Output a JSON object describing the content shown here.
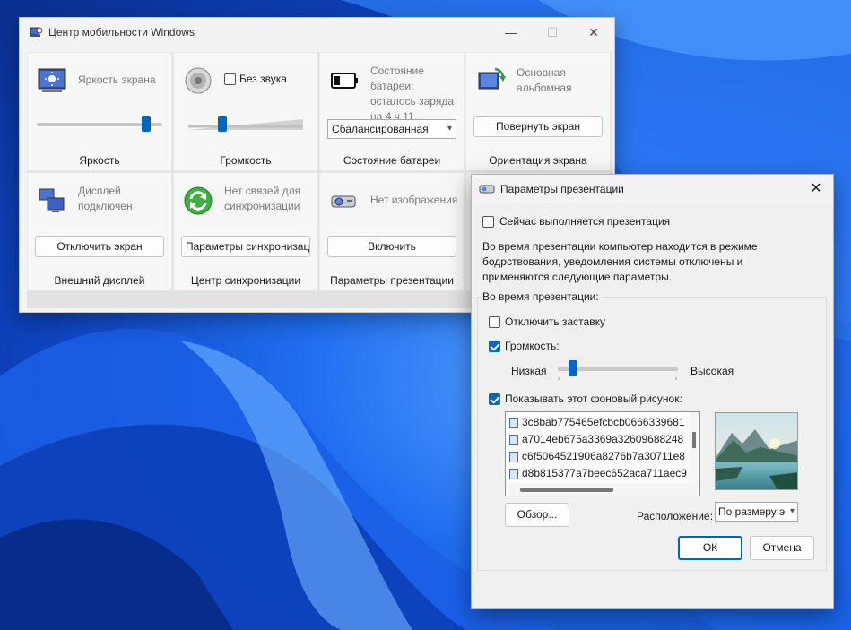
{
  "mobility": {
    "title": "Центр мобильности Windows",
    "brightness": {
      "desc": "Яркость экрана",
      "footer": "Яркость",
      "level": 0.9
    },
    "volume": {
      "mute_label": "Без звука",
      "muted": false,
      "footer": "Громкость",
      "level": 0.28
    },
    "battery": {
      "desc": "Состояние батареи: осталось заряда на 4 ч 11...",
      "plan": "Сбалансированная",
      "footer": "Состояние батареи"
    },
    "orientation": {
      "desc": "Основная альбомная",
      "button": "Повернуть экран",
      "footer": "Ориентация экрана"
    },
    "display": {
      "desc": "Дисплей подключен",
      "button": "Отключить экран",
      "footer": "Внешний дисплей"
    },
    "sync": {
      "desc": "Нет связей для синхронизации",
      "button": "Параметры синхронизации",
      "footer": "Центр синхронизации"
    },
    "presentation": {
      "desc": "Нет изображения",
      "button": "Включить",
      "footer": "Параметры презентации"
    }
  },
  "dialog": {
    "title": "Параметры презентации",
    "presenting_label": "Сейчас выполняется презентация",
    "presenting_checked": false,
    "info_line1": "Во время презентации компьютер находится в режиме",
    "info_line2": "бодрствования, уведомления системы отключены и",
    "info_line3": "применяются следующие параметры.",
    "group_label": "Во время презентации:",
    "screensaver_label": "Отключить заставку",
    "screensaver_checked": false,
    "volume_label": "Громкость:",
    "volume_checked": true,
    "low_label": "Низкая",
    "high_label": "Высокая",
    "volume_level": 0.1,
    "background_label": "Показывать этот фоновый рисунок:",
    "background_checked": true,
    "files": [
      "3c8bab775465efcbcb0666339681",
      "a7014eb675a3369a32609688248",
      "c6f5064521906a8276b7a30711e8",
      "d8b815377a7beec652aca711aec9"
    ],
    "browse_button": "Обзор...",
    "position_label": "Расположение:",
    "position_value": "По размеру э",
    "ok_button": "ОК",
    "cancel_button": "Отмена"
  }
}
